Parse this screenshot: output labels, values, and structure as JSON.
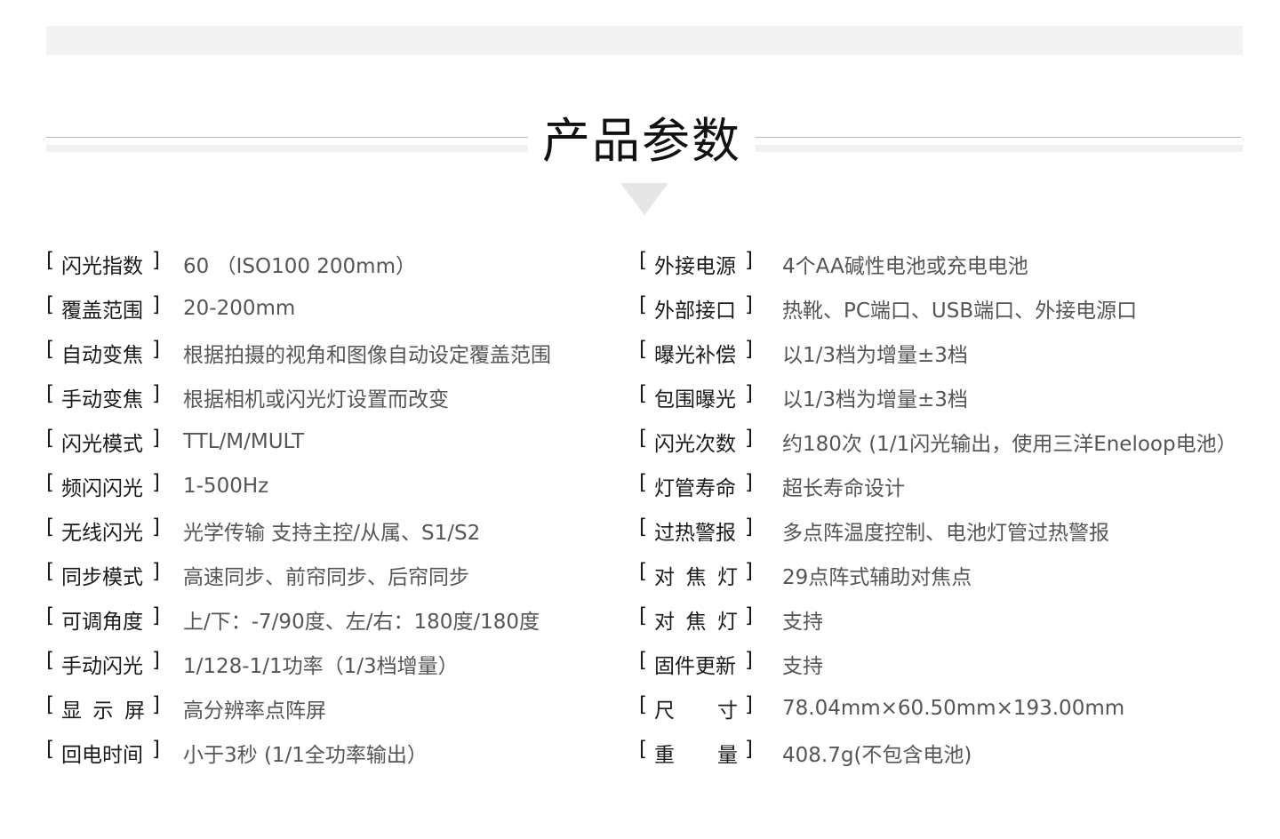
{
  "title": "产品参数",
  "specs_left": [
    {
      "label": "闪光指数",
      "value": "60 （ISO100 200mm）"
    },
    {
      "label": "覆盖范围",
      "value": "20-200mm"
    },
    {
      "label": "自动变焦",
      "value": "根据拍摄的视角和图像自动设定覆盖范围"
    },
    {
      "label": "手动变焦",
      "value": "根据相机或闪光灯设置而改变"
    },
    {
      "label": "闪光模式",
      "value": "TTL/M/MULT"
    },
    {
      "label": "频闪闪光",
      "value": "1-500Hz"
    },
    {
      "label": "无线闪光",
      "value": "光学传输 支持主控/从属、S1/S2"
    },
    {
      "label": "同步模式",
      "value": "高速同步、前帘同步、后帘同步"
    },
    {
      "label": "可调角度",
      "value": "上/下：-7/90度、左/右：180度/180度"
    },
    {
      "label": "手动闪光",
      "value": "1/128-1/1功率（1/3档增量）"
    },
    {
      "label": "显示屏",
      "value": "高分辨率点阵屏"
    },
    {
      "label": "回电时间",
      "value": "小于3秒 (1/1全功率输出）"
    }
  ],
  "specs_right": [
    {
      "label": "外接电源",
      "value": "4个AA碱性电池或充电电池"
    },
    {
      "label": "外部接口",
      "value": "热靴、PC端口、USB端口、外接电源口"
    },
    {
      "label": "曝光补偿",
      "value": "以1/3档为增量±3档"
    },
    {
      "label": "包围曝光",
      "value": "以1/3档为增量±3档"
    },
    {
      "label": "闪光次数",
      "value": "约180次 (1/1闪光输出，使用三洋Eneloop电池）"
    },
    {
      "label": "灯管寿命",
      "value": "超长寿命设计"
    },
    {
      "label": "过热警报",
      "value": "多点阵温度控制、电池灯管过热警报"
    },
    {
      "label": "对焦灯",
      "value": "29点阵式辅助对焦点"
    },
    {
      "label": "对焦灯",
      "value": "支持"
    },
    {
      "label": "固件更新",
      "value": "支持"
    },
    {
      "label": "尺寸",
      "value": "78.04mm×60.50mm×193.00mm"
    },
    {
      "label": "重量",
      "value": "408.7g(不包含电池)"
    }
  ]
}
